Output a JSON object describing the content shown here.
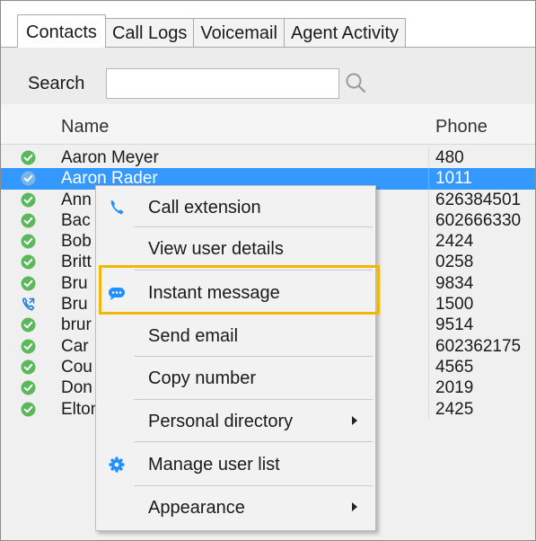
{
  "tabs": [
    {
      "label": "Contacts",
      "active": true
    },
    {
      "label": "Call Logs",
      "active": false
    },
    {
      "label": "Voicemail",
      "active": false
    },
    {
      "label": "Agent Activity",
      "active": false
    }
  ],
  "search": {
    "label": "Search",
    "value": "",
    "placeholder": ""
  },
  "columns": {
    "name": "Name",
    "phone": "Phone"
  },
  "contacts": [
    {
      "name": "Aaron Meyer",
      "phone": "480",
      "status": "available"
    },
    {
      "name": "Aaron Rader",
      "phone": "1011",
      "status": "selected-available"
    },
    {
      "name": "Ann",
      "phone": "626384501",
      "status": "available"
    },
    {
      "name": "Bac",
      "phone": "602666330",
      "status": "available"
    },
    {
      "name": "Bob",
      "phone": "2424",
      "status": "available"
    },
    {
      "name": "Britt",
      "phone": "0258",
      "status": "available"
    },
    {
      "name": "Bru",
      "phone": "9834",
      "status": "available"
    },
    {
      "name": "Bru",
      "phone": "1500",
      "status": "on-call"
    },
    {
      "name": "brur",
      "phone": "9514",
      "status": "available"
    },
    {
      "name": "Car",
      "phone": "602362175",
      "status": "available"
    },
    {
      "name": "Cou",
      "phone": "4565",
      "status": "available"
    },
    {
      "name": "Don",
      "phone": "2019",
      "status": "available"
    },
    {
      "name": "Elton John",
      "phone": "2425",
      "status": "available"
    }
  ],
  "context_menu": {
    "items": [
      {
        "label": "Call extension",
        "icon": "phone-icon",
        "submenu": false
      },
      {
        "label": "View user details",
        "icon": "",
        "submenu": false
      },
      {
        "label": "Instant message",
        "icon": "chat-bubble-icon",
        "submenu": false,
        "highlighted": true
      },
      {
        "label": "Send email",
        "icon": "",
        "submenu": false
      },
      {
        "label": "Copy number",
        "icon": "",
        "submenu": false
      },
      {
        "label": "Personal directory",
        "icon": "",
        "submenu": true
      },
      {
        "label": "Manage user list",
        "icon": "gear-icon",
        "submenu": false
      },
      {
        "label": "Appearance",
        "icon": "",
        "submenu": true
      }
    ]
  },
  "colors": {
    "selection": "#3399ff",
    "available": "#5cb85c",
    "accent_blue": "#1e90ff",
    "highlight_outline": "#f2b705"
  }
}
